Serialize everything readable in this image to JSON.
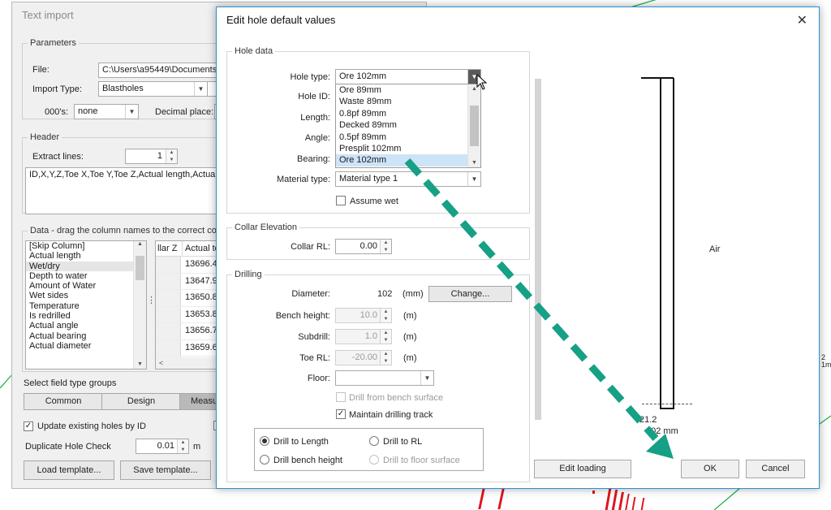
{
  "background_window": {
    "title": "Text import",
    "parameters": {
      "legend": "Parameters",
      "file_label": "File:",
      "file_value": "C:\\Users\\a95449\\Documents\\",
      "import_type_label": "Import Type:",
      "import_type_value": "Blastholes",
      "thousands_label": "000's:",
      "thousands_value": "none",
      "decimal_label": "Decimal place:"
    },
    "header": {
      "legend": "Header",
      "extract_lines_label": "Extract lines:",
      "extract_lines_value": "1",
      "header_text": "ID,X,Y,Z,Toe X,Toe Y,Toe Z,Actual length,Actual"
    },
    "data": {
      "legend": "Data - drag the column names to the correct colu",
      "columns": [
        "[Skip Column]",
        "Actual length",
        "Wet/dry",
        "Depth to water",
        "Amount of Water",
        "Wet sides",
        "Temperature",
        "Is redrilled",
        "Actual angle",
        "Actual bearing",
        "Actual diameter"
      ],
      "selected_column": "Wet/dry",
      "grid_headers": [
        "llar Z",
        "Actual to"
      ],
      "grid_values": [
        "13696.43",
        "13647.95",
        "13650.87",
        "13653.8",
        "13656.73",
        "13659.66",
        "13662.58"
      ]
    },
    "field_groups": {
      "label": "Select field type groups",
      "tabs": [
        "Common",
        "Design",
        "Measu"
      ]
    },
    "update_existing_label": "Update existing holes by ID",
    "update_existing_checked": true,
    "duplicate_check_label": "Duplicate Hole Check",
    "duplicate_check_value": "0.01",
    "duplicate_check_unit": "m",
    "load_template": "Load template...",
    "save_template": "Save template..."
  },
  "dialog": {
    "title": "Edit hole default values",
    "close_icon": "close-icon",
    "hole_data": {
      "legend": "Hole data",
      "hole_type_label": "Hole type:",
      "hole_type_value": "Ore 102mm",
      "hole_type_options": [
        "Ore 89mm",
        "Waste 89mm",
        "0.8pf 89mm",
        "Decked 89mm",
        "0.5pf 89mm",
        "Presplit 102mm",
        "Ore 102mm"
      ],
      "highlighted_option": "Ore 102mm",
      "hole_id_label": "Hole ID:",
      "length_label": "Length:",
      "angle_label": "Angle:",
      "bearing_label": "Bearing:",
      "material_type_label": "Material type:",
      "material_type_value": "Material type 1",
      "assume_wet_label": "Assume wet",
      "assume_wet_checked": false
    },
    "collar_elevation": {
      "legend": "Collar Elevation",
      "collar_rl_label": "Collar RL:",
      "collar_rl_value": "0.00"
    },
    "drilling": {
      "legend": "Drilling",
      "diameter_label": "Diameter:",
      "diameter_value": "102",
      "diameter_unit": "(mm)",
      "change_button": "Change...",
      "bench_height_label": "Bench height:",
      "bench_height_value": "10.0",
      "bench_height_unit": "(m)",
      "subdrill_label": "Subdrill:",
      "subdrill_value": "1.0",
      "subdrill_unit": "(m)",
      "toe_rl_label": "Toe RL:",
      "toe_rl_value": "-20.00",
      "toe_rl_unit": "(m)",
      "floor_label": "Floor:",
      "floor_value": "",
      "drill_from_bench_label": "Drill from bench surface",
      "drill_from_bench_checked": false,
      "maintain_track_label": "Maintain drilling track",
      "maintain_track_checked": true,
      "modes": [
        {
          "label": "Drill to Length",
          "selected": true,
          "enabled": true
        },
        {
          "label": "Drill to RL",
          "selected": false,
          "enabled": true
        },
        {
          "label": "Drill bench height",
          "selected": false,
          "enabled": true
        },
        {
          "label": "Drill to floor surface",
          "selected": false,
          "enabled": false
        }
      ]
    },
    "preview": {
      "air_label": "Air",
      "depth_label": "21.2",
      "diameter_label": "102 mm"
    },
    "edit_loading_button": "Edit loading",
    "ok_button": "OK",
    "cancel_button": "Cancel"
  },
  "overflow_text": {
    "line1": "2",
    "line2": "1m"
  },
  "colors": {
    "accent_border": "#2f8fd6",
    "arrow": "#16a085",
    "lines_green": "#22b14c",
    "marks_red": "#e0141b"
  },
  "annotation": {
    "icon": "dashed-arrow-icon"
  }
}
